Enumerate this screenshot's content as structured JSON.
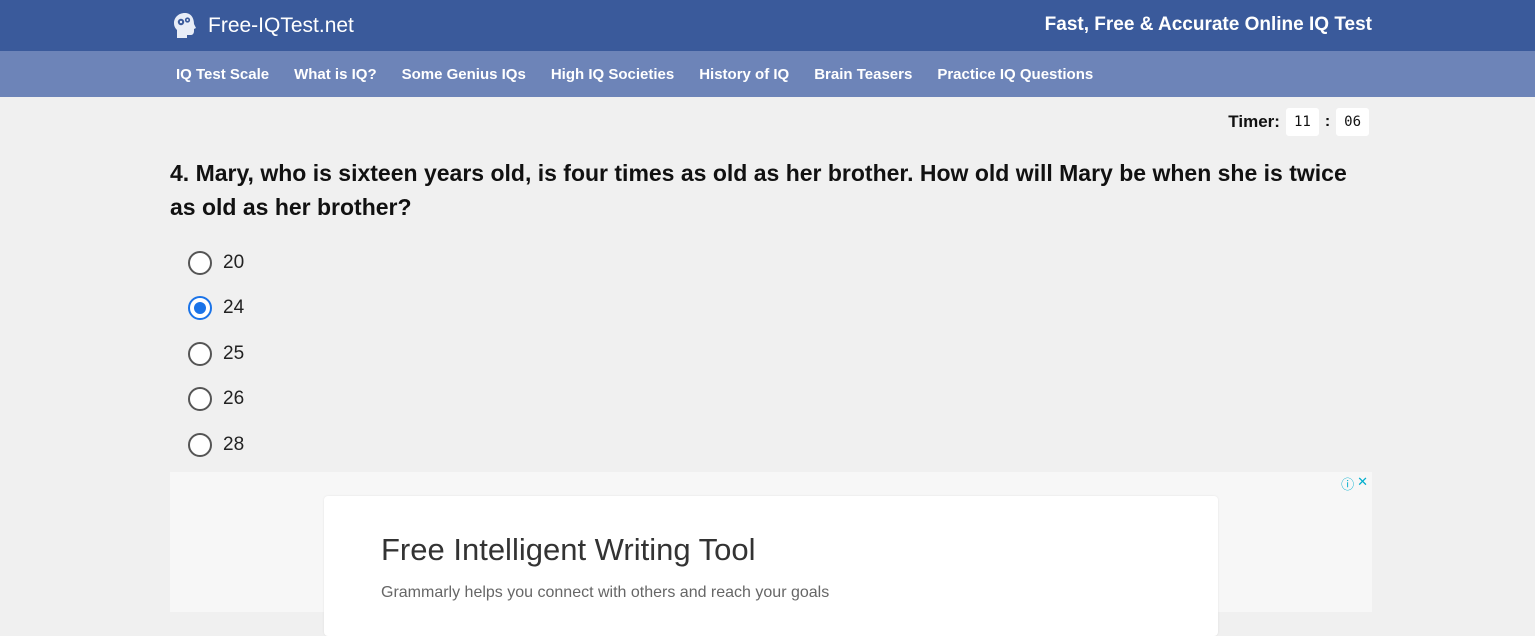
{
  "header": {
    "brand": "Free-IQTest.net",
    "brand_icon": "head-gears-icon",
    "tagline": "Fast, Free & Accurate Online IQ Test",
    "bg_color": "#3a5a9b"
  },
  "nav": {
    "items": [
      {
        "label": "IQ Test Scale"
      },
      {
        "label": "What is IQ?"
      },
      {
        "label": "Some Genius IQs"
      },
      {
        "label": "High IQ Societies"
      },
      {
        "label": "History of IQ"
      },
      {
        "label": "Brain Teasers"
      },
      {
        "label": "Practice IQ Questions"
      }
    ],
    "bg_color": "#6d84b8"
  },
  "timer": {
    "label": "Timer:",
    "minutes": "11",
    "separator": ":",
    "seconds": "06"
  },
  "question": {
    "text": "4. Mary, who is sixteen years old, is four times as old as her brother. How old will Mary be when she is twice as old as her brother?",
    "options": [
      {
        "label": "20",
        "selected": false
      },
      {
        "label": "24",
        "selected": true
      },
      {
        "label": "25",
        "selected": false
      },
      {
        "label": "26",
        "selected": false
      },
      {
        "label": "28",
        "selected": false
      }
    ],
    "accent_color": "#1a73e8"
  },
  "ad": {
    "title": "Free Intelligent Writing Tool",
    "subtitle": "Grammarly helps you connect with others and reach your goals",
    "info_icon": "info-icon",
    "close_icon": "close-icon",
    "info_glyph": "ⓘ",
    "close_glyph": "✕"
  }
}
